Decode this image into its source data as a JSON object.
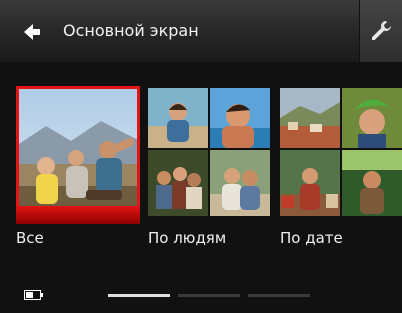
{
  "header": {
    "title": "Основной экран",
    "back_icon": "back-arrow-icon",
    "settings_icon": "wrench-icon"
  },
  "categories": [
    {
      "label": "Все"
    },
    {
      "label": "По людям"
    },
    {
      "label": "По дате"
    }
  ],
  "pager": {
    "pages": 3,
    "active": 0
  },
  "colors": {
    "accent": "#e31414",
    "background": "#0d0d0d",
    "header": "#262626"
  }
}
